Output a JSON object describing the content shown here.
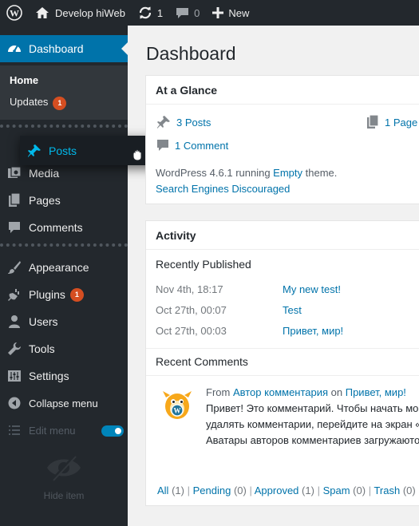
{
  "adminbar": {
    "site_name": "Develop hiWeb",
    "updates_count": "1",
    "comments_count": "0",
    "new_label": "New"
  },
  "sidebar": {
    "dashboard_label": "Dashboard",
    "submenu": {
      "home": "Home",
      "updates": "Updates",
      "updates_badge": "1"
    },
    "dragging_label": "Posts",
    "items": {
      "media": "Media",
      "pages": "Pages",
      "comments": "Comments",
      "appearance": "Appearance",
      "plugins": "Plugins",
      "plugins_badge": "1",
      "users": "Users",
      "tools": "Tools",
      "settings": "Settings",
      "collapse": "Collapse menu",
      "edit_menu": "Edit menu",
      "hide_item": "Hide item"
    }
  },
  "main": {
    "page_title": "Dashboard",
    "glance": {
      "title": "At a Glance",
      "posts": "3 Posts",
      "pages": "1 Page",
      "comments": "1 Comment",
      "wp_running_prefix": "WordPress 4.6.1 running ",
      "theme_name": "Empty",
      "wp_running_suffix": " theme.",
      "search_engines": "Search Engines Discouraged"
    },
    "activity": {
      "title": "Activity",
      "recently_published": "Recently Published",
      "posts": [
        {
          "date": "Nov 4th, 18:17",
          "title": "My new test!"
        },
        {
          "date": "Oct 27th, 00:07",
          "title": "Test"
        },
        {
          "date": "Oct 27th, 00:03",
          "title": "Привет, мир!"
        }
      ],
      "recent_comments": "Recent Comments",
      "comment": {
        "from": "From ",
        "author": "Автор комментария",
        "on": " on ",
        "post": "Привет, мир!",
        "line2": "Привет! Это комментарий. Чтобы начать мо",
        "line3a": "удалять комментарии, перейдите на экран «",
        "line3b": "К",
        "line4": "Аватары авторов комментариев загружаюто"
      },
      "filters": {
        "all": "All",
        "all_count": "(1)",
        "pending": "Pending",
        "pending_count": "(0)",
        "approved": "Approved",
        "approved_count": "(1)",
        "spam": "Spam",
        "spam_count": "(0)",
        "trash": "Trash",
        "trash_count": "(0)",
        "sep": "|"
      }
    }
  }
}
